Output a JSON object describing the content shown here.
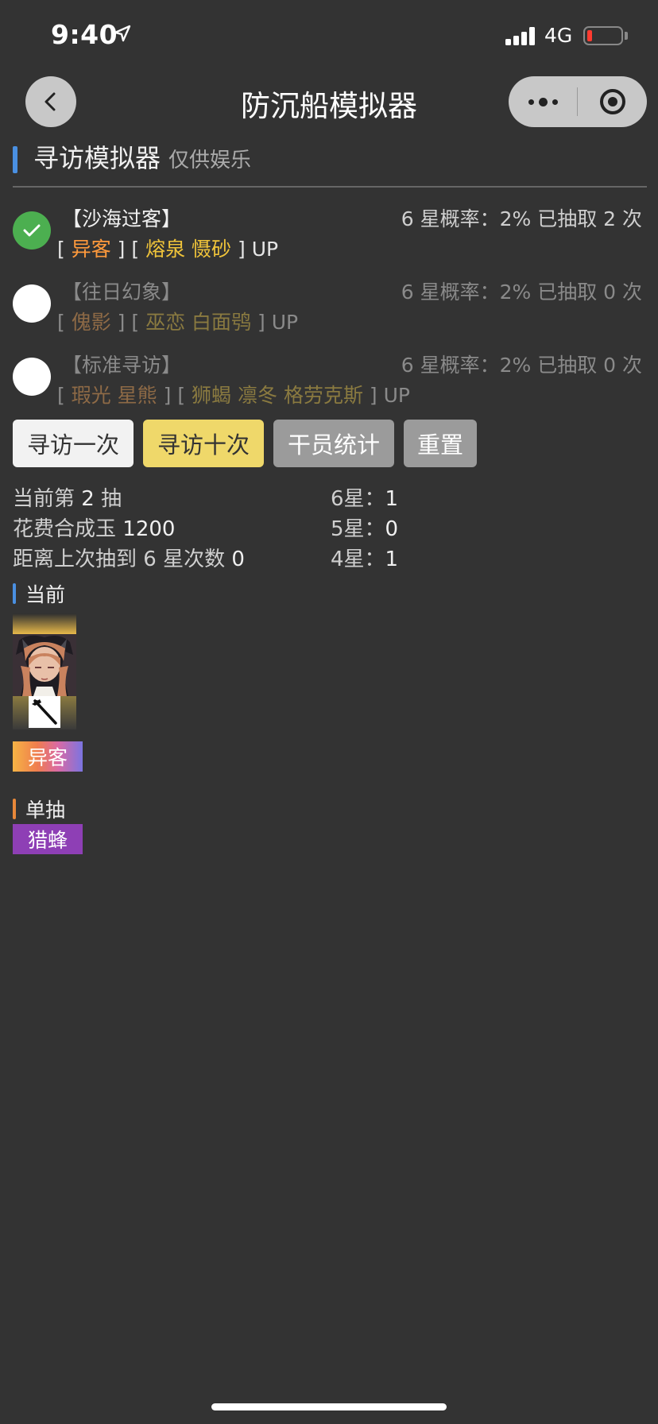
{
  "status": {
    "time": "9:40",
    "network": "4G"
  },
  "nav": {
    "title": "防沉船模拟器"
  },
  "section": {
    "title": "寻访模拟器",
    "subtitle": "仅供娱乐"
  },
  "pools": [
    {
      "name": "【沙海过客】",
      "rate": "6 星概率：2% 已抽取 2 次",
      "checked": true,
      "groups": [
        [
          "异客"
        ],
        [
          "熔泉",
          "慑砂"
        ]
      ],
      "up": "UP"
    },
    {
      "name": "【往日幻象】",
      "rate": "6 星概率：2% 已抽取 0 次",
      "checked": false,
      "groups": [
        [
          "傀影"
        ],
        [
          "巫恋",
          "白面鸮"
        ]
      ],
      "up": "UP"
    },
    {
      "name": "【标准寻访】",
      "rate": "6 星概率：2% 已抽取 0 次",
      "checked": false,
      "groups": [
        [
          "瑕光",
          "星熊"
        ],
        [
          "狮蝎",
          "凛冬",
          "格劳克斯"
        ]
      ],
      "up": "UP"
    }
  ],
  "buttons": {
    "once": "寻访一次",
    "ten": "寻访十次",
    "stats": "干员统计",
    "reset": "重置"
  },
  "stats": {
    "current_label": "当前第",
    "current_value": "2",
    "current_unit": "抽",
    "cost_label": "花费合成玉",
    "cost_value": "1200",
    "since_label": "距离上次抽到 6 星次数",
    "since_value": "0",
    "six_label": "6星：",
    "six_value": "1",
    "five_label": "5星：",
    "five_value": "0",
    "four_label": "4星：",
    "four_value": "1"
  },
  "current": {
    "title": "当前",
    "operator": "异客"
  },
  "single": {
    "title": "单抽",
    "operator": "猎蜂"
  },
  "colors": {
    "accent_blue": "#4a90e2",
    "accent_orange": "#e8883a",
    "six_star": "#ff9a3c",
    "five_star": "#f0c43a",
    "check": "#4caf50",
    "purple": "#8e3fb5"
  },
  "icons": {
    "back": "chevron-left-icon",
    "more": "more-dots-icon",
    "target": "target-icon",
    "check": "check-icon",
    "class": "guard-class-icon"
  }
}
